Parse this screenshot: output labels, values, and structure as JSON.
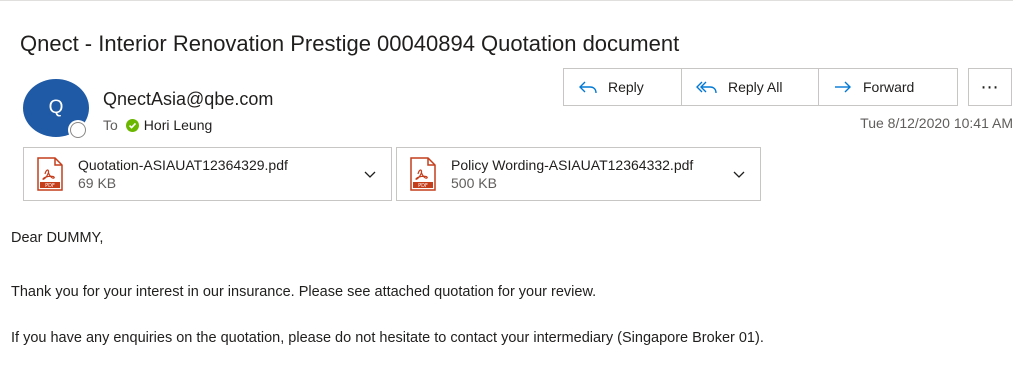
{
  "email": {
    "subject": "Qnect - Interior Renovation Prestige 00040894 Quotation document",
    "sender": {
      "initial": "Q",
      "address": "QnectAsia@qbe.com"
    },
    "to": {
      "label": "To",
      "recipient": "Hori Leung",
      "status_color": "#6bb700"
    },
    "timestamp": "Tue 8/12/2020 10:41 AM"
  },
  "actions": {
    "reply": "Reply",
    "reply_all": "Reply All",
    "forward": "Forward",
    "more": "⋯"
  },
  "attachments": [
    {
      "name": "Quotation-ASIAUAT12364329.pdf",
      "size": "69 KB",
      "icon": "pdf-file-icon"
    },
    {
      "name": "Policy Wording-ASIAUAT12364332.pdf",
      "size": "500 KB",
      "icon": "pdf-file-icon"
    }
  ],
  "body": {
    "greeting": "Dear DUMMY,",
    "paragraph1": "Thank you for your interest in our insurance. Please see attached quotation for your review.",
    "paragraph2": "If you have any enquiries on the quotation, please do not hesitate to contact your intermediary (Singapore Broker 01)."
  },
  "colors": {
    "avatar": "#1f5aa6",
    "accent": "#0078d4",
    "pdf_red": "#c43e1c"
  }
}
